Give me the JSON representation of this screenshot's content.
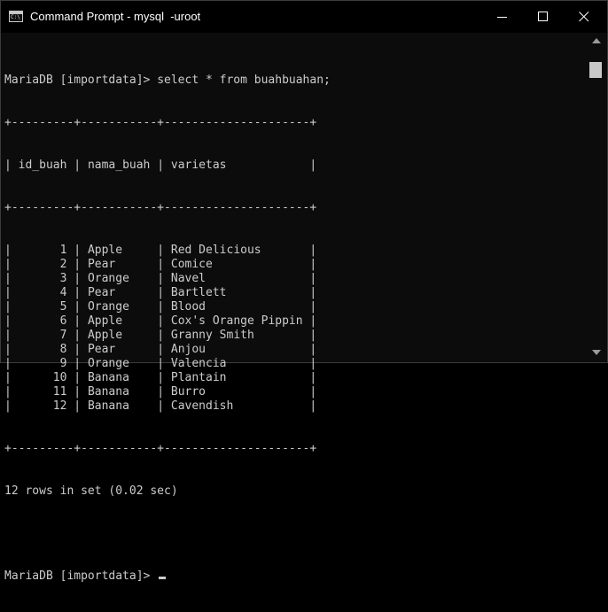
{
  "window": {
    "icon_label": "C:\\",
    "title": "Command Prompt - mysql  -uroot"
  },
  "terminal": {
    "prompt": "MariaDB [importdata]> ",
    "command": "select * from buahbuahan;",
    "border": "+---------+-----------+---------------------+",
    "headers": [
      "id_buah",
      "nama_buah",
      "varietas"
    ],
    "rows": [
      [
        "1",
        "Apple",
        "Red Delicious"
      ],
      [
        "2",
        "Pear",
        "Comice"
      ],
      [
        "3",
        "Orange",
        "Navel"
      ],
      [
        "4",
        "Pear",
        "Bartlett"
      ],
      [
        "5",
        "Orange",
        "Blood"
      ],
      [
        "6",
        "Apple",
        "Cox's Orange Pippin"
      ],
      [
        "7",
        "Apple",
        "Granny Smith"
      ],
      [
        "8",
        "Pear",
        "Anjou"
      ],
      [
        "9",
        "Orange",
        "Valencia"
      ],
      [
        "10",
        "Banana",
        "Plantain"
      ],
      [
        "11",
        "Banana",
        "Burro"
      ],
      [
        "12",
        "Banana",
        "Cavendish"
      ]
    ],
    "result_summary": "12 rows in set (0.02 sec)",
    "final_prompt": "MariaDB [importdata]> "
  },
  "colors": {
    "background": "#0c0c0c",
    "text": "#cccccc",
    "titlebar": "#000000"
  },
  "icons": {
    "app": "cmd-icon",
    "minimize": "minimize-icon",
    "maximize": "maximize-icon",
    "close": "close-icon"
  }
}
